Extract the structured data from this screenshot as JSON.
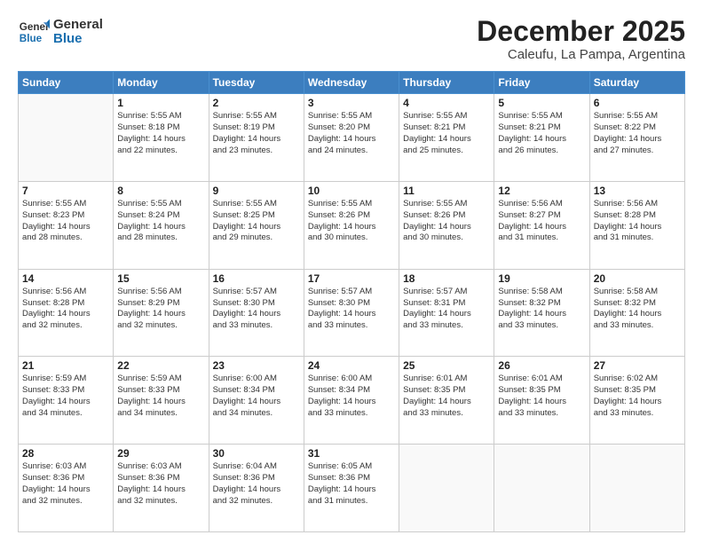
{
  "logo": {
    "line1": "General",
    "line2": "Blue"
  },
  "title": "December 2025",
  "subtitle": "Caleufu, La Pampa, Argentina",
  "header_days": [
    "Sunday",
    "Monday",
    "Tuesday",
    "Wednesday",
    "Thursday",
    "Friday",
    "Saturday"
  ],
  "weeks": [
    [
      {
        "num": "",
        "info": ""
      },
      {
        "num": "1",
        "info": "Sunrise: 5:55 AM\nSunset: 8:18 PM\nDaylight: 14 hours\nand 22 minutes."
      },
      {
        "num": "2",
        "info": "Sunrise: 5:55 AM\nSunset: 8:19 PM\nDaylight: 14 hours\nand 23 minutes."
      },
      {
        "num": "3",
        "info": "Sunrise: 5:55 AM\nSunset: 8:20 PM\nDaylight: 14 hours\nand 24 minutes."
      },
      {
        "num": "4",
        "info": "Sunrise: 5:55 AM\nSunset: 8:21 PM\nDaylight: 14 hours\nand 25 minutes."
      },
      {
        "num": "5",
        "info": "Sunrise: 5:55 AM\nSunset: 8:21 PM\nDaylight: 14 hours\nand 26 minutes."
      },
      {
        "num": "6",
        "info": "Sunrise: 5:55 AM\nSunset: 8:22 PM\nDaylight: 14 hours\nand 27 minutes."
      }
    ],
    [
      {
        "num": "7",
        "info": "Sunrise: 5:55 AM\nSunset: 8:23 PM\nDaylight: 14 hours\nand 28 minutes."
      },
      {
        "num": "8",
        "info": "Sunrise: 5:55 AM\nSunset: 8:24 PM\nDaylight: 14 hours\nand 28 minutes."
      },
      {
        "num": "9",
        "info": "Sunrise: 5:55 AM\nSunset: 8:25 PM\nDaylight: 14 hours\nand 29 minutes."
      },
      {
        "num": "10",
        "info": "Sunrise: 5:55 AM\nSunset: 8:26 PM\nDaylight: 14 hours\nand 30 minutes."
      },
      {
        "num": "11",
        "info": "Sunrise: 5:55 AM\nSunset: 8:26 PM\nDaylight: 14 hours\nand 30 minutes."
      },
      {
        "num": "12",
        "info": "Sunrise: 5:56 AM\nSunset: 8:27 PM\nDaylight: 14 hours\nand 31 minutes."
      },
      {
        "num": "13",
        "info": "Sunrise: 5:56 AM\nSunset: 8:28 PM\nDaylight: 14 hours\nand 31 minutes."
      }
    ],
    [
      {
        "num": "14",
        "info": "Sunrise: 5:56 AM\nSunset: 8:28 PM\nDaylight: 14 hours\nand 32 minutes."
      },
      {
        "num": "15",
        "info": "Sunrise: 5:56 AM\nSunset: 8:29 PM\nDaylight: 14 hours\nand 32 minutes."
      },
      {
        "num": "16",
        "info": "Sunrise: 5:57 AM\nSunset: 8:30 PM\nDaylight: 14 hours\nand 33 minutes."
      },
      {
        "num": "17",
        "info": "Sunrise: 5:57 AM\nSunset: 8:30 PM\nDaylight: 14 hours\nand 33 minutes."
      },
      {
        "num": "18",
        "info": "Sunrise: 5:57 AM\nSunset: 8:31 PM\nDaylight: 14 hours\nand 33 minutes."
      },
      {
        "num": "19",
        "info": "Sunrise: 5:58 AM\nSunset: 8:32 PM\nDaylight: 14 hours\nand 33 minutes."
      },
      {
        "num": "20",
        "info": "Sunrise: 5:58 AM\nSunset: 8:32 PM\nDaylight: 14 hours\nand 33 minutes."
      }
    ],
    [
      {
        "num": "21",
        "info": "Sunrise: 5:59 AM\nSunset: 8:33 PM\nDaylight: 14 hours\nand 34 minutes."
      },
      {
        "num": "22",
        "info": "Sunrise: 5:59 AM\nSunset: 8:33 PM\nDaylight: 14 hours\nand 34 minutes."
      },
      {
        "num": "23",
        "info": "Sunrise: 6:00 AM\nSunset: 8:34 PM\nDaylight: 14 hours\nand 34 minutes."
      },
      {
        "num": "24",
        "info": "Sunrise: 6:00 AM\nSunset: 8:34 PM\nDaylight: 14 hours\nand 33 minutes."
      },
      {
        "num": "25",
        "info": "Sunrise: 6:01 AM\nSunset: 8:35 PM\nDaylight: 14 hours\nand 33 minutes."
      },
      {
        "num": "26",
        "info": "Sunrise: 6:01 AM\nSunset: 8:35 PM\nDaylight: 14 hours\nand 33 minutes."
      },
      {
        "num": "27",
        "info": "Sunrise: 6:02 AM\nSunset: 8:35 PM\nDaylight: 14 hours\nand 33 minutes."
      }
    ],
    [
      {
        "num": "28",
        "info": "Sunrise: 6:03 AM\nSunset: 8:36 PM\nDaylight: 14 hours\nand 32 minutes."
      },
      {
        "num": "29",
        "info": "Sunrise: 6:03 AM\nSunset: 8:36 PM\nDaylight: 14 hours\nand 32 minutes."
      },
      {
        "num": "30",
        "info": "Sunrise: 6:04 AM\nSunset: 8:36 PM\nDaylight: 14 hours\nand 32 minutes."
      },
      {
        "num": "31",
        "info": "Sunrise: 6:05 AM\nSunset: 8:36 PM\nDaylight: 14 hours\nand 31 minutes."
      },
      {
        "num": "",
        "info": ""
      },
      {
        "num": "",
        "info": ""
      },
      {
        "num": "",
        "info": ""
      }
    ]
  ]
}
